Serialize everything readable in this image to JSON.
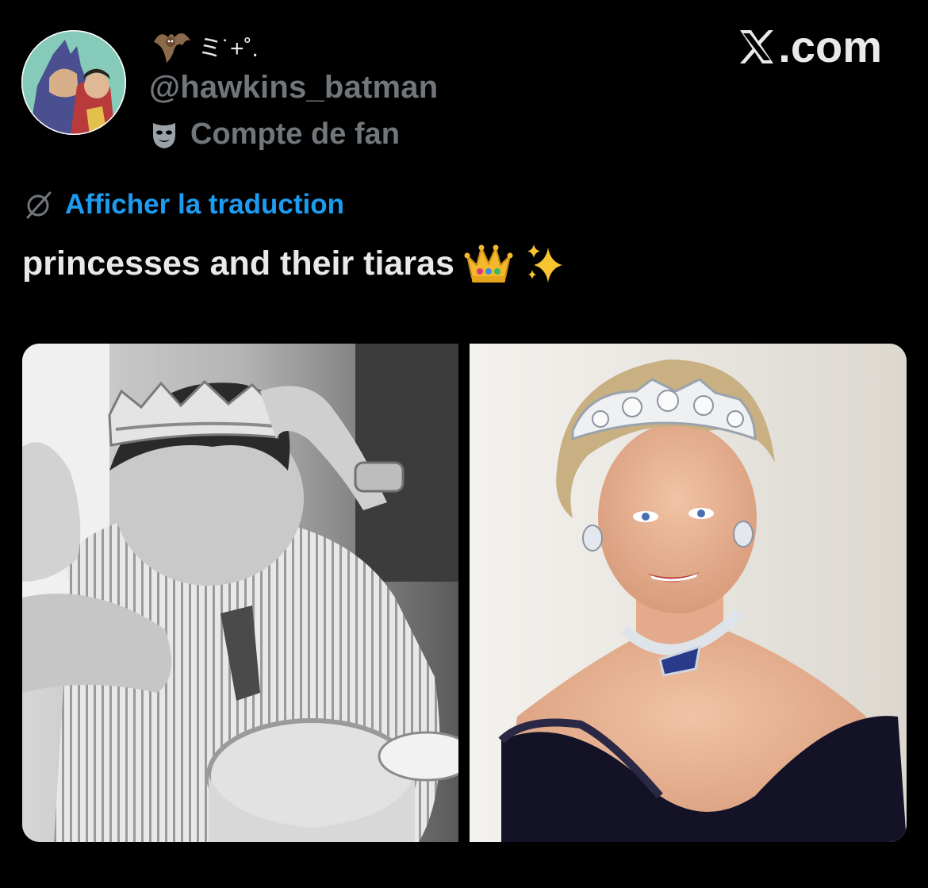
{
  "author": {
    "display_name": "ミ˙+˚.",
    "handle": "@hawkins_batman",
    "badge": "Compte de fan",
    "avatar": "avatar-illustration"
  },
  "site": {
    "logo_text": ".com"
  },
  "tweet": {
    "translate_label": "Afficher la traduction",
    "text": "princesses and their tiaras",
    "emojis": [
      "crown-emoji",
      "sparkles-emoji"
    ]
  },
  "media": [
    {
      "name": "photo-bw-crown",
      "description_icon": "photo"
    },
    {
      "name": "photo-tiara-portrait",
      "description_icon": "photo"
    }
  ],
  "colors": {
    "link": "#1d9bf0",
    "muted": "#71767b",
    "text": "#e7e9ea",
    "background": "#000000"
  }
}
